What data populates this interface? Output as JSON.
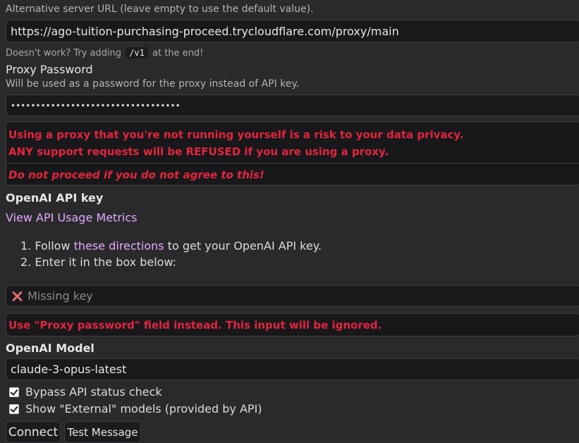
{
  "server": {
    "label": "Alternative server URL (leave empty to use the default value).",
    "url_value": "https://ago-tuition-purchasing-proceed.trycloudflare.com/proxy/main",
    "hint_before": "Doesn't work? Try adding",
    "hint_code": "/v1",
    "hint_after": "at the end!"
  },
  "proxy_password": {
    "title": "Proxy Password",
    "description": "Will be used as a password for the proxy instead of API key.",
    "masked_value": "••••••••••••••••••••••••••••••••••"
  },
  "warning": {
    "line1": "Using a proxy that you're not running yourself is a risk to your data privacy.",
    "line2": "ANY support requests will be REFUSED if you are using a proxy.",
    "line3": "Do not proceed if you do not agree to this!"
  },
  "api_key": {
    "title": "OpenAI API key",
    "usage_link": "View API Usage Metrics",
    "step1_prefix": "1. Follow",
    "step1_link": "these directions",
    "step1_suffix": "to get your OpenAI API key.",
    "step2": "2. Enter it in the box below:",
    "missing_text": "Missing key",
    "ignored_warning": "Use \"Proxy password\" field instead. This input will be ignored."
  },
  "model": {
    "title": "OpenAI Model",
    "selected": "claude-3-opus-latest"
  },
  "options": {
    "bypass_label": "Bypass API status check",
    "bypass_checked": true,
    "external_label": "Show \"External\" models (provided by API)",
    "external_checked": true
  },
  "buttons": {
    "connect": "Connect",
    "test": "Test Message"
  },
  "colors": {
    "warning_red": "#e3243f",
    "link_purple": "#e6a8ff",
    "background": "#2a2a2c"
  },
  "icons": {
    "missing_key": "x-mark-icon"
  }
}
